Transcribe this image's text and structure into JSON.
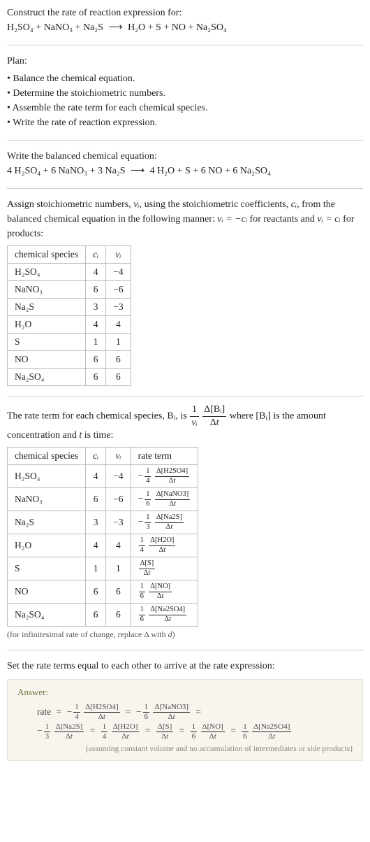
{
  "intro": {
    "line1": "Construct the rate of reaction expression for:",
    "equation_left": "H₂SO₄ + NaNO₃ + Na₂S",
    "arrow": "⟶",
    "equation_right": "H₂O + S + NO + Na₂SO₄"
  },
  "plan": {
    "title": "Plan:",
    "items": [
      "Balance the chemical equation.",
      "Determine the stoichiometric numbers.",
      "Assemble the rate term for each chemical species.",
      "Write the rate of reaction expression."
    ]
  },
  "balanced": {
    "intro": "Write the balanced chemical equation:",
    "left": "4 H₂SO₄ + 6 NaNO₃ + 3 Na₂S",
    "arrow": "⟶",
    "right": "4 H₂O + S + 6 NO + 6 Na₂SO₄"
  },
  "stoich": {
    "intro_a": "Assign stoichiometric numbers, ",
    "nu_i": "νᵢ",
    "intro_b": ", using the stoichiometric coefficients, ",
    "c_i": "cᵢ",
    "intro_c": ", from the balanced chemical equation in the following manner: ",
    "rel_react": "νᵢ = −cᵢ",
    "intro_d": " for reactants and ",
    "rel_prod": "νᵢ = cᵢ",
    "intro_e": " for products:",
    "headers": {
      "species": "chemical species",
      "c": "cᵢ",
      "nu": "νᵢ"
    },
    "rows": [
      {
        "sp": "H₂SO₄",
        "c": "4",
        "nu": "−4"
      },
      {
        "sp": "NaNO₃",
        "c": "6",
        "nu": "−6"
      },
      {
        "sp": "Na₂S",
        "c": "3",
        "nu": "−3"
      },
      {
        "sp": "H₂O",
        "c": "4",
        "nu": "4"
      },
      {
        "sp": "S",
        "c": "1",
        "nu": "1"
      },
      {
        "sp": "NO",
        "c": "6",
        "nu": "6"
      },
      {
        "sp": "Na₂SO₄",
        "c": "6",
        "nu": "6"
      }
    ]
  },
  "rateterm": {
    "pre_a": "The rate term for each chemical species, B",
    "pre_b": ", is ",
    "one": "1",
    "nu": "νᵢ",
    "dB": "Δ[Bᵢ]",
    "dt": "Δt",
    "mid": " where [B",
    "mid2": "] is the amount concentration and ",
    "t": "t",
    "tail": " is time:",
    "headers": {
      "species": "chemical species",
      "c": "cᵢ",
      "nu": "νᵢ",
      "rt": "rate term"
    },
    "rows": [
      {
        "sp": "H₂SO₄",
        "c": "4",
        "nu": "−4",
        "sign": "−",
        "coef_num": "1",
        "coef_den": "4",
        "dnum": "Δ[H2SO4]",
        "dden": "Δt"
      },
      {
        "sp": "NaNO₃",
        "c": "6",
        "nu": "−6",
        "sign": "−",
        "coef_num": "1",
        "coef_den": "6",
        "dnum": "Δ[NaNO3]",
        "dden": "Δt"
      },
      {
        "sp": "Na₂S",
        "c": "3",
        "nu": "−3",
        "sign": "−",
        "coef_num": "1",
        "coef_den": "3",
        "dnum": "Δ[Na2S]",
        "dden": "Δt"
      },
      {
        "sp": "H₂O",
        "c": "4",
        "nu": "4",
        "sign": "",
        "coef_num": "1",
        "coef_den": "4",
        "dnum": "Δ[H2O]",
        "dden": "Δt"
      },
      {
        "sp": "S",
        "c": "1",
        "nu": "1",
        "sign": "",
        "coef_num": "",
        "coef_den": "",
        "dnum": "Δ[S]",
        "dden": "Δt"
      },
      {
        "sp": "NO",
        "c": "6",
        "nu": "6",
        "sign": "",
        "coef_num": "1",
        "coef_den": "6",
        "dnum": "Δ[NO]",
        "dden": "Δt"
      },
      {
        "sp": "Na₂SO₄",
        "c": "6",
        "nu": "6",
        "sign": "",
        "coef_num": "1",
        "coef_den": "6",
        "dnum": "Δ[Na2SO4]",
        "dden": "Δt"
      }
    ],
    "footnote": "(for infinitesimal rate of change, replace Δ with d)"
  },
  "final": {
    "intro": "Set the rate terms equal to each other to arrive at the rate expression:",
    "answer_label": "Answer:",
    "rate_word": "rate",
    "minus": "−",
    "equals": "=",
    "terms": [
      {
        "sign": "−",
        "coef_num": "1",
        "coef_den": "4",
        "dnum": "Δ[H2SO4]",
        "dden": "Δt"
      },
      {
        "sign": "−",
        "coef_num": "1",
        "coef_den": "6",
        "dnum": "Δ[NaNO3]",
        "dden": "Δt"
      },
      {
        "sign": "−",
        "coef_num": "1",
        "coef_den": "3",
        "dnum": "Δ[Na2S]",
        "dden": "Δt"
      },
      {
        "sign": "",
        "coef_num": "1",
        "coef_den": "4",
        "dnum": "Δ[H2O]",
        "dden": "Δt"
      },
      {
        "sign": "",
        "coef_num": "",
        "coef_den": "",
        "dnum": "Δ[S]",
        "dden": "Δt"
      },
      {
        "sign": "",
        "coef_num": "1",
        "coef_den": "6",
        "dnum": "Δ[NO]",
        "dden": "Δt"
      },
      {
        "sign": "",
        "coef_num": "1",
        "coef_den": "6",
        "dnum": "Δ[Na2SO4]",
        "dden": "Δt"
      }
    ],
    "foot": "(assuming constant volume and no accumulation of intermediates or side products)"
  }
}
